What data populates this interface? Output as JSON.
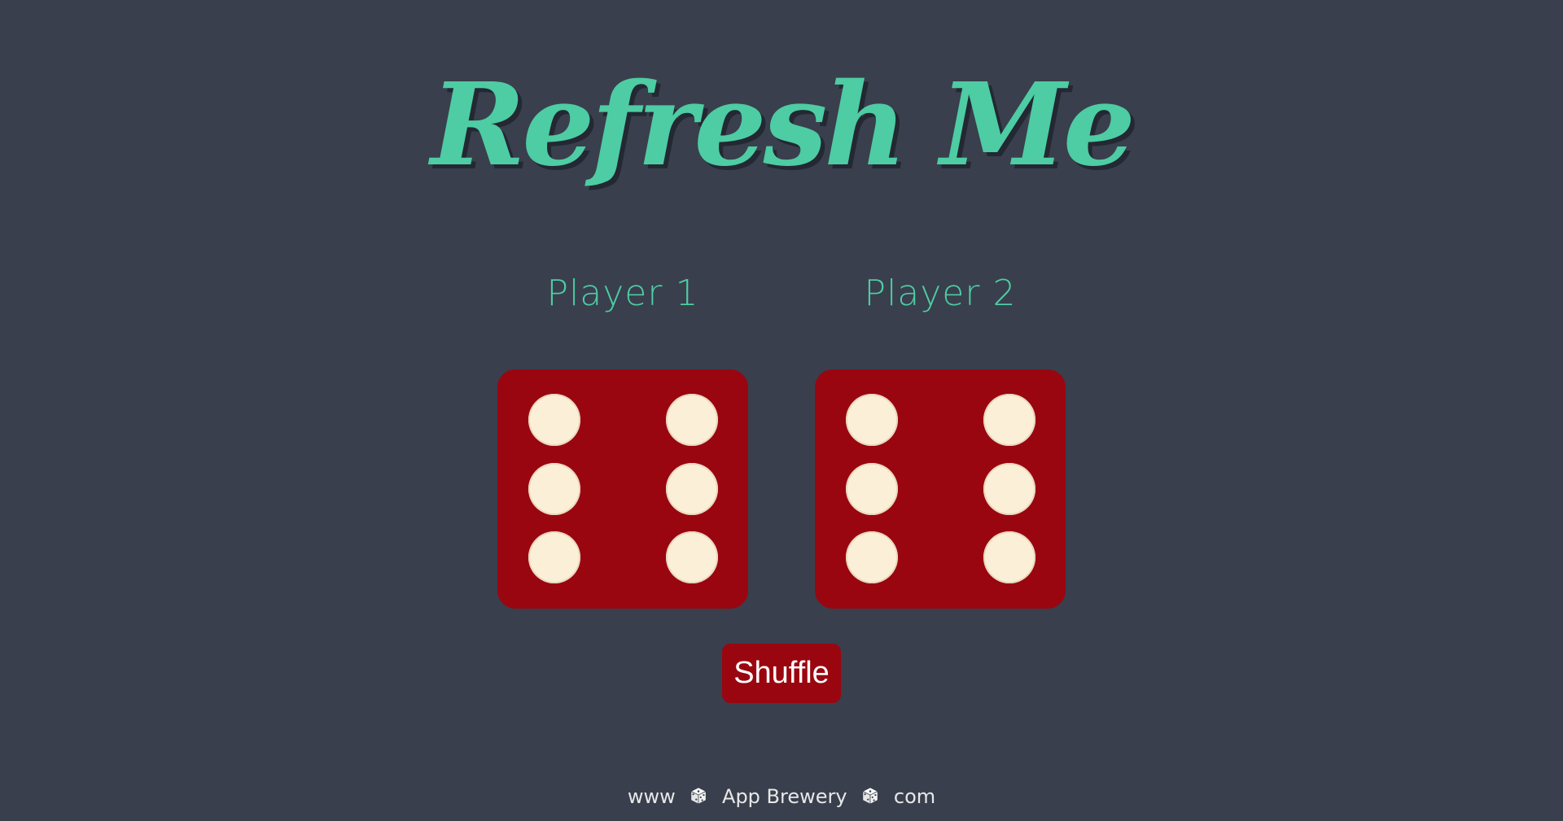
{
  "title": "Refresh Me",
  "players": [
    {
      "label": "Player 1",
      "die_value": 6
    },
    {
      "label": "Player 2",
      "die_value": 6
    }
  ],
  "shuffle_button": {
    "label": "Shuffle"
  },
  "footer": {
    "part1": "www",
    "part2": "App Brewery",
    "part3": "com",
    "icon": "dice-icon"
  },
  "colors": {
    "background": "#393f4d",
    "accent": "#4ecca3",
    "die": "#9a0610",
    "pip": "#fbf0d7"
  }
}
